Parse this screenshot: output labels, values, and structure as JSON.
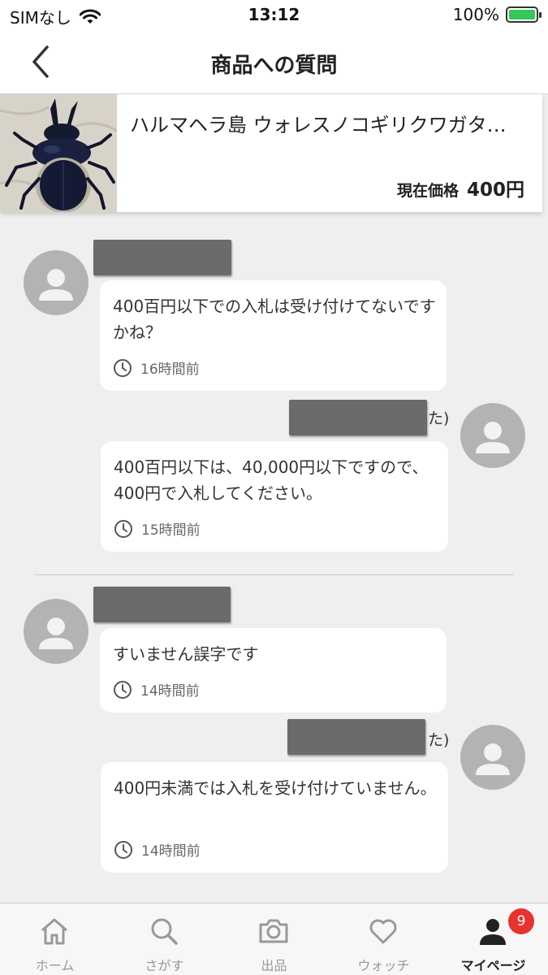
{
  "status_bar": {
    "carrier": "SIMなし",
    "time": "13:12",
    "battery_percent": "100%",
    "battery_level": 1.0
  },
  "nav": {
    "title": "商品への質問",
    "back_icon": "chevron-left-icon"
  },
  "product": {
    "name": "ハルマヘラ島 ウォレスノコギリクワガタ…",
    "price_label": "現在価格",
    "price_value": "400円"
  },
  "messages": [
    {
      "side": "left",
      "name_suffix": "",
      "text": "400百円以下での入札は受け付けてないですかね？",
      "time": "16時間前"
    },
    {
      "side": "right",
      "name_suffix": "た)",
      "text": "400百円以下は、40,000円以下ですので、400円で入札してください。",
      "time": "15時間前"
    },
    {
      "side": "left",
      "name_suffix": "",
      "text": "すいません誤字です",
      "time": "14時間前"
    },
    {
      "side": "right",
      "name_suffix": "た)",
      "text": "400円未満では入札を受け付けていません。",
      "time": "14時間前"
    }
  ],
  "tabs": [
    {
      "label": "ホーム",
      "icon": "home-icon",
      "active": false
    },
    {
      "label": "さがす",
      "icon": "search-icon",
      "active": false
    },
    {
      "label": "出品",
      "icon": "camera-icon",
      "active": false
    },
    {
      "label": "ウォッチ",
      "icon": "heart-icon",
      "active": false
    },
    {
      "label": "マイページ",
      "icon": "person-icon",
      "active": true,
      "badge": "9"
    }
  ],
  "colors": {
    "accent_badge": "#e8322e",
    "background": "#efefef",
    "battery_green": "#35c759"
  }
}
